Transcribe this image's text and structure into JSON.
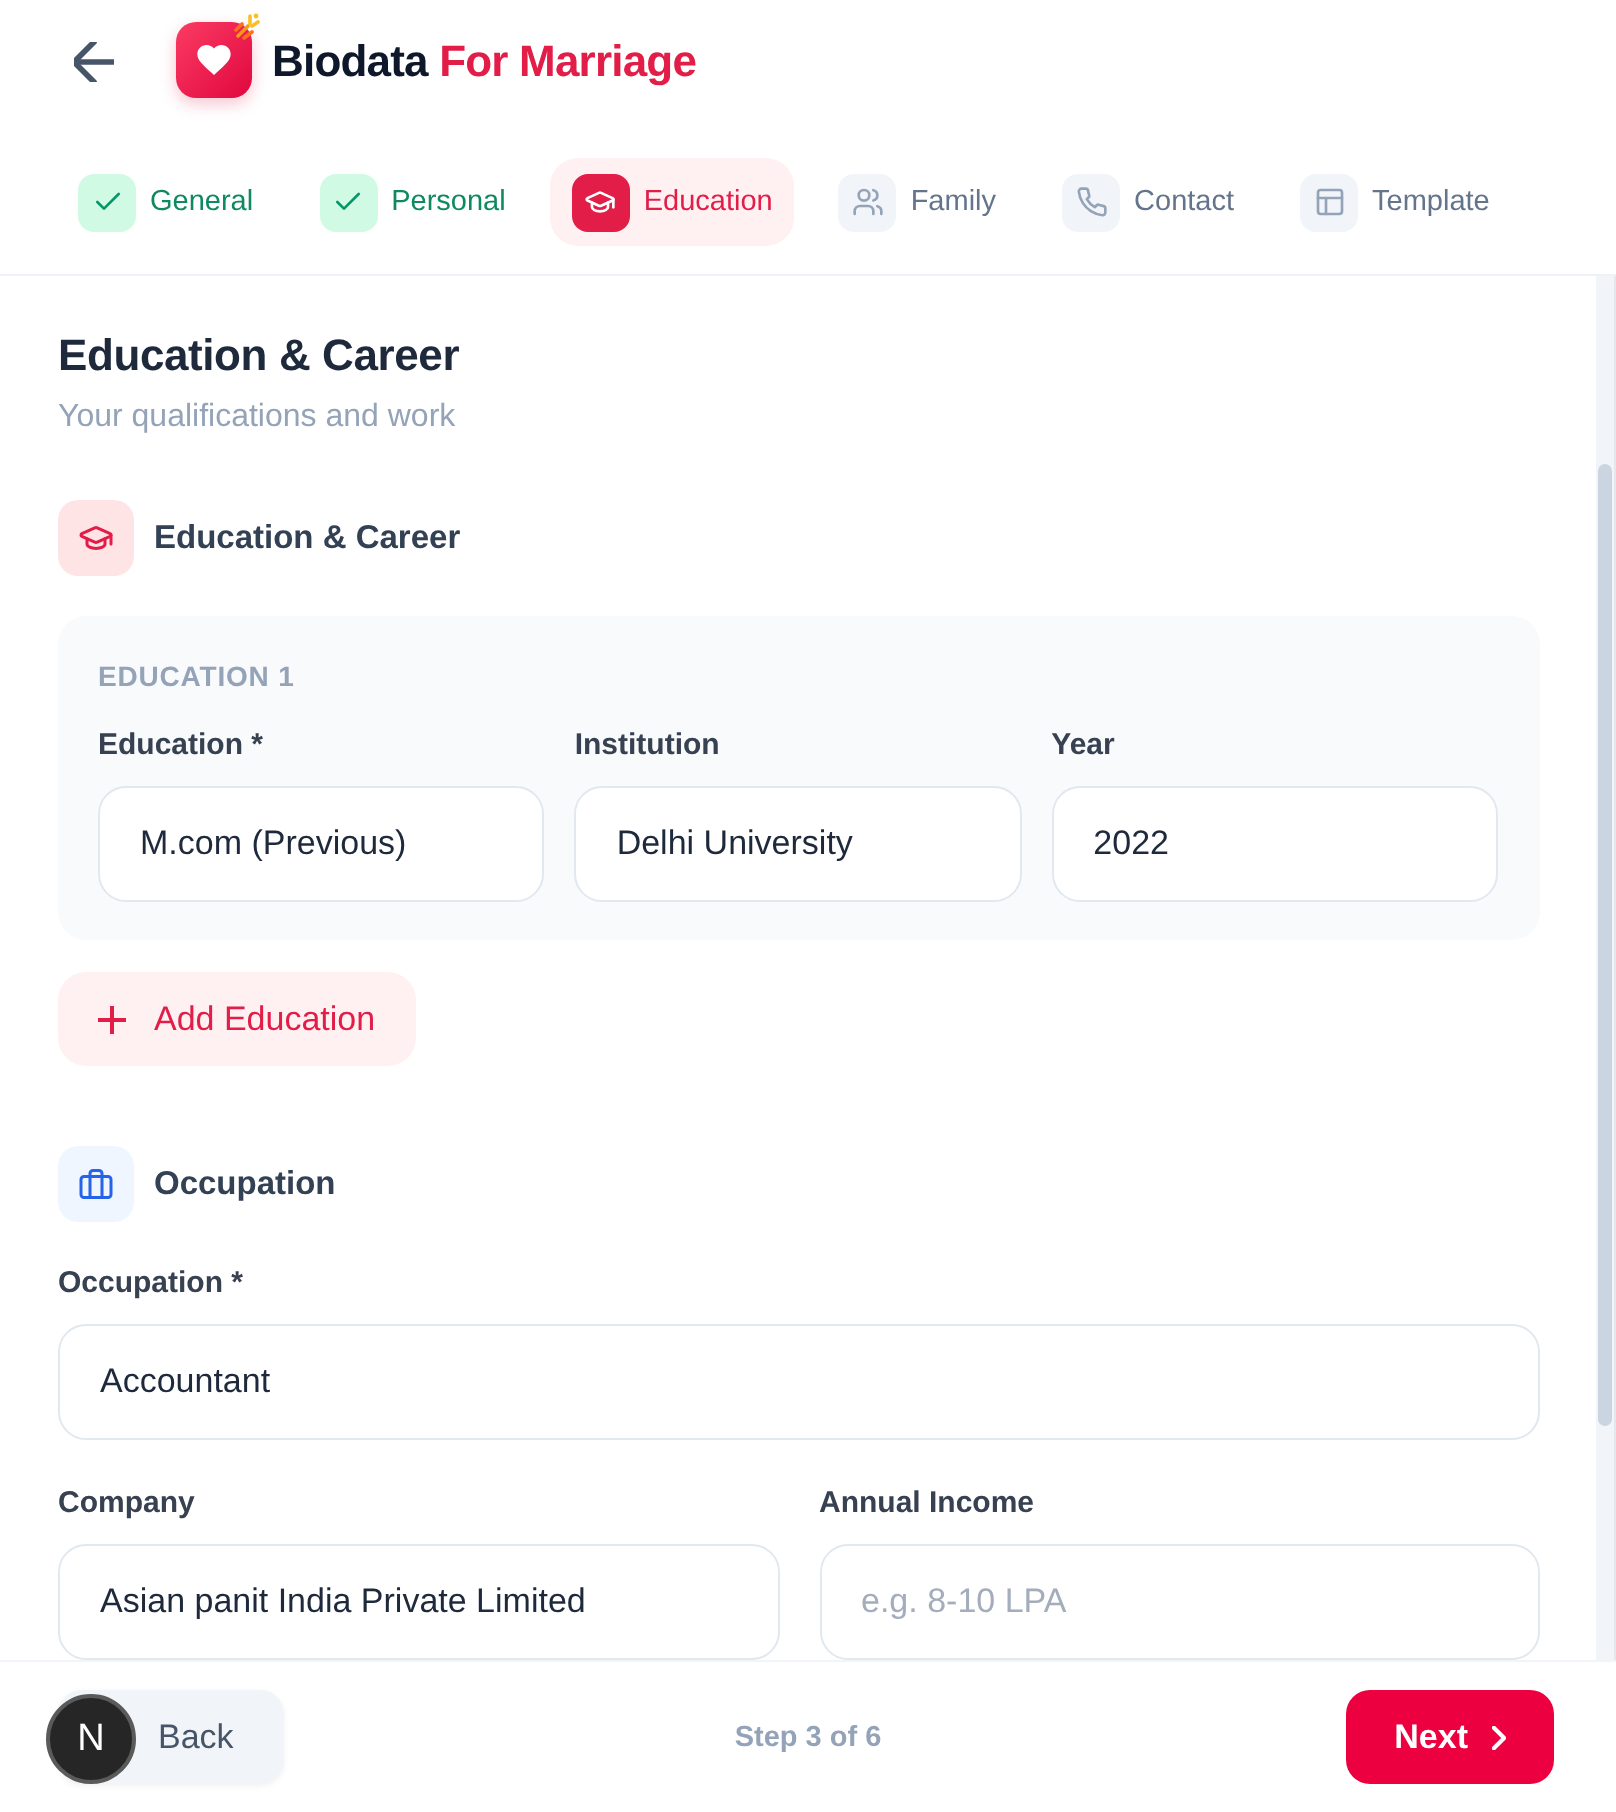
{
  "header": {
    "title": "Biodata",
    "title_accent": "For Marriage"
  },
  "steps": [
    {
      "label": "General",
      "selected": false,
      "completed": true
    },
    {
      "label": "Personal",
      "selected": false,
      "completed": true
    },
    {
      "label": "Education",
      "selected": true,
      "completed": false
    },
    {
      "label": "Family",
      "selected": false,
      "completed": false
    },
    {
      "label": "Contact",
      "selected": false,
      "completed": false
    },
    {
      "label": "Template",
      "selected": false,
      "completed": false
    }
  ],
  "page": {
    "title": "Education & Career",
    "subtitle": "Your qualifications and work"
  },
  "sections": [
    {
      "kind": "education",
      "title": "Education & Career",
      "entries": [
        {
          "heading": "EDUCATION 1",
          "fields": [
            {
              "label": "Education *",
              "value": "M.com (Previous)"
            },
            {
              "label": "Institution",
              "value": "Delhi University"
            },
            {
              "label": "Year",
              "value": "2022"
            }
          ]
        }
      ],
      "add_button": "Add Education"
    },
    {
      "kind": "occupation",
      "title": "Occupation",
      "fields": [
        {
          "label": "Occupation *",
          "value": "Accountant"
        },
        {
          "label": "Company",
          "value": "Asian panit India Private Limited"
        },
        {
          "label": "Annual Income",
          "placeholder": "e.g. 8-10 LPA"
        }
      ]
    }
  ],
  "footer": {
    "back": "Back",
    "step_text": "Step 3 of 6",
    "next": "Next",
    "dev_badge": "N"
  }
}
